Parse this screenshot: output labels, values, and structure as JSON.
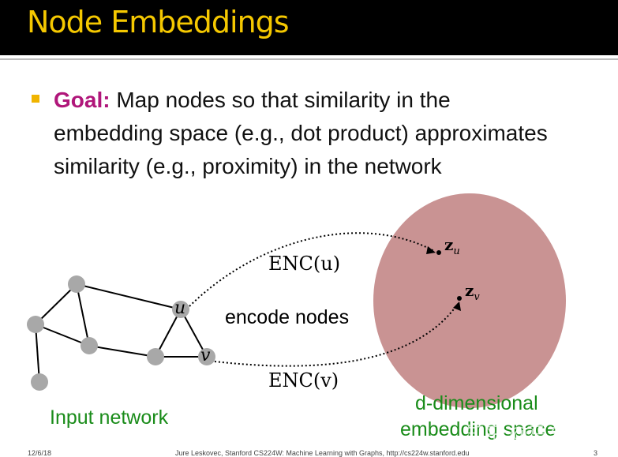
{
  "title": "Node Embeddings",
  "goal": {
    "label": "Goal:",
    "text": "Map nodes so that similarity in the embedding space (e.g., dot product) approximates similarity (e.g., proximity) in the network"
  },
  "diagram": {
    "node_u": "u",
    "node_v": "v",
    "enc_u": "ENC(u)",
    "enc_v": "ENC(v)",
    "encode": "encode nodes",
    "z_u": "z",
    "z_u_sub": "u",
    "z_v": "z",
    "z_v_sub": "v",
    "input_label": "Input network",
    "space_label_1": "d-dimensional",
    "space_label_2": "embedding space",
    "colors": {
      "ellipse": "#c99393",
      "node": "#a8a8a8",
      "label": "#1a8c1a"
    }
  },
  "footer": {
    "date": "12/6/18",
    "credit": "Jure Leskovec, Stanford CS224W: Machine Learning with Graphs, http://cs224w.stanford.edu",
    "page": "3"
  },
  "watermark": "知乎 @马东什么"
}
